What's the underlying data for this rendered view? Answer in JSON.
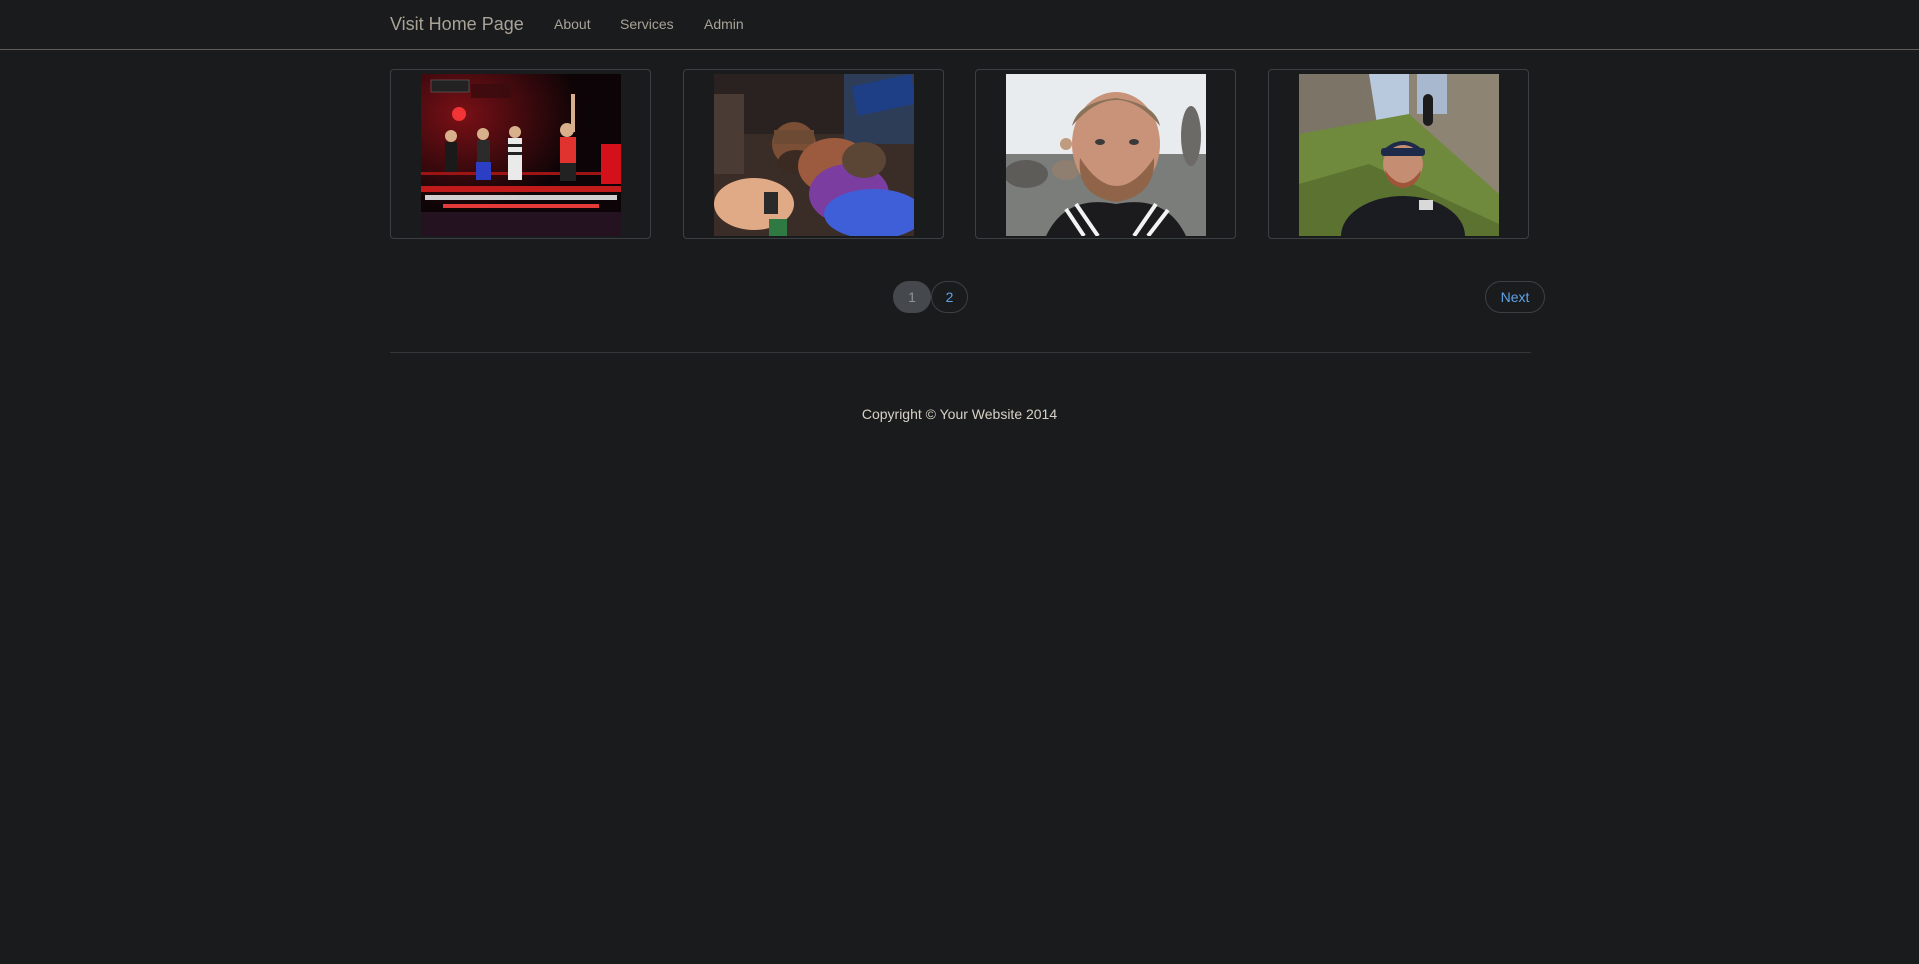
{
  "navbar": {
    "brand": "Visit Home Page",
    "links": [
      "About",
      "Services",
      "Admin"
    ]
  },
  "gallery": {
    "items": [
      {
        "image": "boxing-event-poster"
      },
      {
        "image": "vr-avatar-boxing"
      },
      {
        "image": "man-selfie-outdoors"
      },
      {
        "image": "man-at-castle-ruins"
      }
    ]
  },
  "pagination": {
    "pages": [
      "1",
      "2"
    ],
    "active_page": "1",
    "next_label": "Next"
  },
  "footer": {
    "copyright": "Copyright © Your Website 2014"
  },
  "colors": {
    "background": "#1a1b1d",
    "link": "#5ea4e8",
    "nav_text": "#a9a397"
  }
}
